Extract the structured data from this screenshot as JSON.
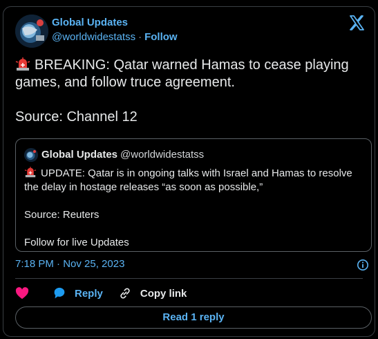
{
  "author": {
    "name": "Global Updates",
    "handle": "@worldwidestatss",
    "separator": "·",
    "follow_label": "Follow"
  },
  "tweet": {
    "emoji": "rotating-light-icon",
    "text": "BREAKING: Qatar warned Hamas to cease playing games, and follow truce agreement.\n\nSource: Channel 12"
  },
  "quote": {
    "name": "Global Updates",
    "handle": "@worldwidestatss",
    "emoji": "rotating-light-icon",
    "text": "UPDATE: Qatar is in ongoing talks with Israel and Hamas to resolve the delay in hostage releases “as soon as possible,”\n\nSource: Reuters\n\nFollow for live Updates"
  },
  "meta": {
    "timestamp": "7:18 PM · Nov 25, 2023"
  },
  "actions": {
    "reply_label": "Reply",
    "copy_label": "Copy link"
  },
  "footer": {
    "read_replies_label": "Read 1 reply"
  },
  "colors": {
    "accent": "#5ab3f3",
    "like": "#f91880",
    "reply": "#1d9bf0",
    "siren": "#e53935"
  }
}
